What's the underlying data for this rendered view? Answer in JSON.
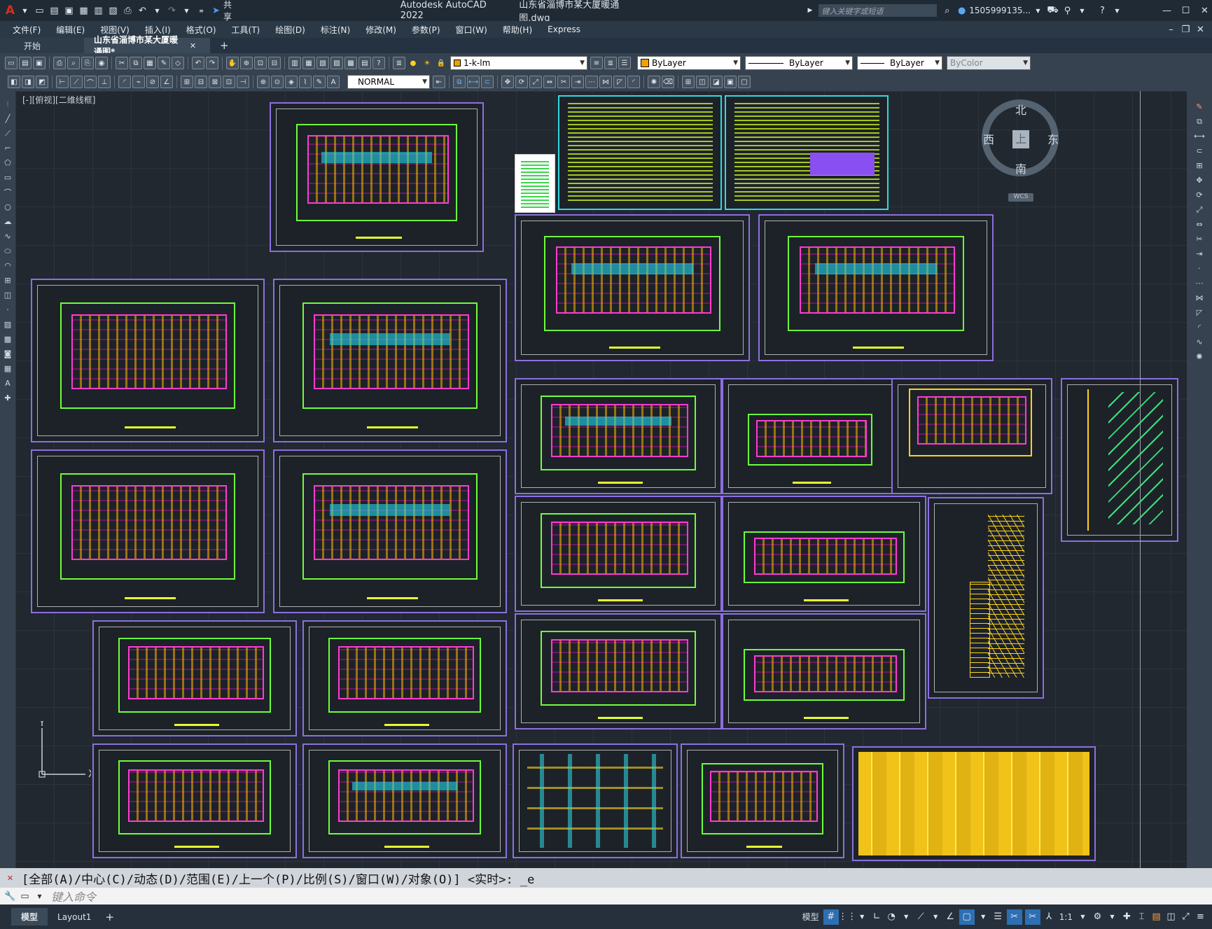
{
  "title": {
    "app_title": "Autodesk AutoCAD 2022",
    "file_title": "山东省淄博市某大厦暖通图.dwg",
    "search_placeholder": "键入关键字或短语",
    "user": "1505999135...",
    "share": "共享"
  },
  "menu": [
    "文件(F)",
    "编辑(E)",
    "视图(V)",
    "插入(I)",
    "格式(O)",
    "工具(T)",
    "绘图(D)",
    "标注(N)",
    "修改(M)",
    "参数(P)",
    "窗口(W)",
    "帮助(H)",
    "Express"
  ],
  "tabs": {
    "start": "开始",
    "active": "山东省淄博市某大厦暖通图*",
    "add": "+"
  },
  "toolbar": {
    "layer": "1-k-lm",
    "color": "ByLayer",
    "linetype": "ByLayer",
    "lineweight": "ByLayer",
    "plotstyle": "ByColor",
    "dimstyle": "NORMAL"
  },
  "viewport_label": "[-][俯视][二维线框]",
  "viewcube": {
    "north": "北",
    "south": "南",
    "east": "东",
    "west": "西",
    "top": "上",
    "wcs": "WCS"
  },
  "ucs": {
    "x": "X",
    "y": "Y"
  },
  "command": {
    "history": "[全部(A)/中心(C)/动态(D)/范围(E)/上一个(P)/比例(S)/窗口(W)/对象(O)] <实时>: _e",
    "placeholder": "键入命令"
  },
  "layout_tabs": [
    "模型",
    "Layout1",
    "+"
  ],
  "status": {
    "model": "模型",
    "scale": "1:1"
  }
}
